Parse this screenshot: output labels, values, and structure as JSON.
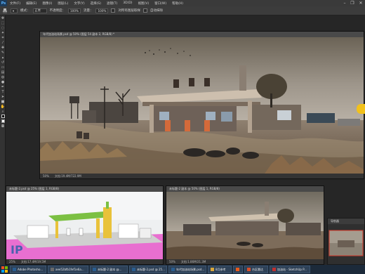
{
  "menubar": {
    "logo": "Ps",
    "items": [
      "文件(F)",
      "编辑(E)",
      "图像(I)",
      "图层(L)",
      "文字(Y)",
      "选择(S)",
      "滤镜(T)",
      "3D(D)",
      "视图(V)",
      "窗口(W)",
      "帮助(H)"
    ],
    "minimize": "–",
    "restore": "❐",
    "close": "✕"
  },
  "options": {
    "mode_label": "模式：",
    "mode_value": "正常",
    "opacity_label": "不透明度：",
    "opacity_value": "100%",
    "flow_label": "流量：",
    "flow_value": "100%",
    "sample_all": "对所有图层取样",
    "auto_erase": "自动抹除"
  },
  "main_doc": {
    "title": "年代加油站场景.psd @ 50% (图层 54 副本 2, RGB/8) *",
    "zoom": "50%",
    "docinfo": "文档:19.4M/722.9M"
  },
  "doc_left": {
    "title": "未标题-2.psd @ 25% (图层 1, RGB/8)",
    "zoom": "25%",
    "docinfo": "文档:17.4M/19.5M",
    "watermark": "IP"
  },
  "doc_right": {
    "title": "未标题-2 副本 @ 50% (图层 1, RGB/8)",
    "zoom": "50%",
    "docinfo": "文档:1.86M/21.3M"
  },
  "navigator": {
    "title": "导航器"
  },
  "taskbar": {
    "items": [
      {
        "label": "Adobe Photosho...",
        "color": "#2a5d8f"
      },
      {
        "label": "aee52bfb1fef1e6a...",
        "color": "#6a6a6a"
      },
      {
        "label": "未标题-2 副本 @...",
        "color": "#2a5d8f"
      },
      {
        "label": "未标题-2.psd @ 25...",
        "color": "#2a5d8f"
      },
      {
        "label": "年代加油站场景.psd...",
        "color": "#2a5d8f"
      },
      {
        "label": "8月参考",
        "color": "#d9a73a"
      },
      {
        "label": "",
        "color": "#e85a1c"
      },
      {
        "label": "台区雷达",
        "color": "#d94e2a"
      },
      {
        "label": "加油站 - SketchUp P...",
        "color": "#c03030"
      }
    ]
  },
  "colors": {
    "accent_dot": "#f2c11b",
    "ground_pink": "#e86fd0",
    "canopy_green": "#7cc043",
    "canopy_yellow": "#e9c23a"
  }
}
